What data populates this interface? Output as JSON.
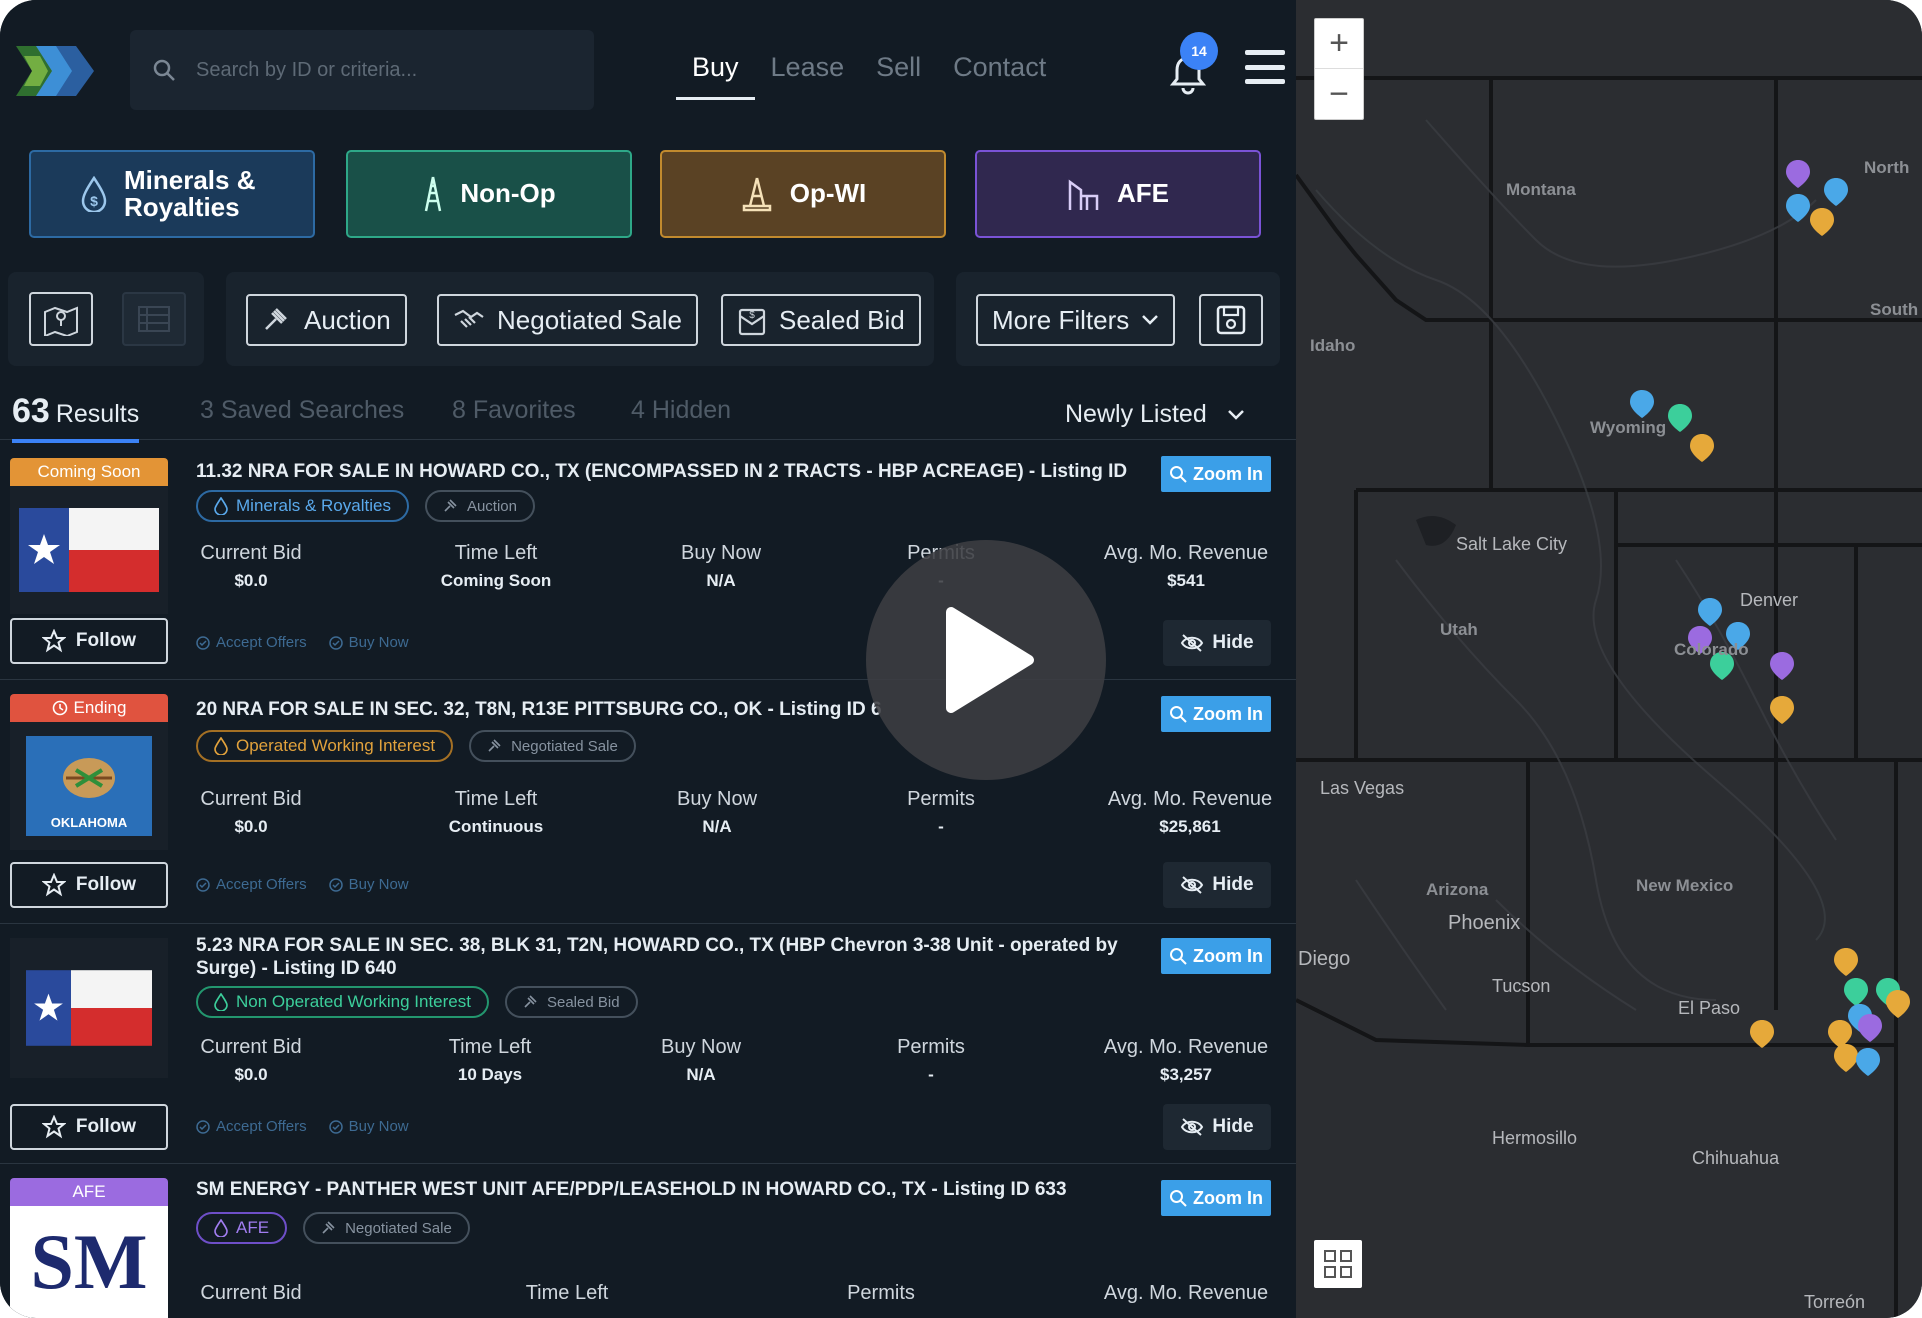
{
  "header": {
    "search_placeholder": "Search by ID or criteria...",
    "nav": [
      "Buy",
      "Lease",
      "Sell",
      "Contact"
    ],
    "active_nav": "Buy",
    "notification_count": "14"
  },
  "categories": [
    {
      "label": "Minerals & Royalties",
      "icon": "dollar-drop-icon",
      "color": "#1b3a5a"
    },
    {
      "label": "Non-Op",
      "icon": "oil-derrick-icon",
      "color": "#195048"
    },
    {
      "label": "Op-WI",
      "icon": "oil-rig-icon",
      "color": "#5a4224"
    },
    {
      "label": "AFE",
      "icon": "pumpjack-icon",
      "color": "#30284f"
    }
  ],
  "filters": {
    "auction": "Auction",
    "negotiated": "Negotiated Sale",
    "sealed": "Sealed Bid",
    "more": "More Filters"
  },
  "tabs": {
    "results_count": "63",
    "results_label": "Results",
    "saved": "3 Saved Searches",
    "favorites": "8 Favorites",
    "hidden": "4 Hidden",
    "sort": "Newly Listed"
  },
  "common": {
    "zoom_in": "Zoom In",
    "follow": "Follow",
    "hide": "Hide",
    "accept_offers": "Accept Offers",
    "buy_now": "Buy Now",
    "current_bid": "Current Bid",
    "time_left": "Time Left",
    "buy_now_label": "Buy Now",
    "permits": "Permits",
    "avg_revenue": "Avg. Mo. Revenue"
  },
  "listings": [
    {
      "status": "Coming Soon",
      "title": "11.32 NRA FOR SALE IN HOWARD CO., TX (ENCOMPASSED IN 2 TRACTS - HBP ACREAGE) - Listing ID",
      "tags": [
        "Minerals & Royalties",
        "Auction"
      ],
      "current_bid": "$0.0",
      "time_left": "Coming Soon",
      "buy_now": "N/A",
      "permits": "Permits",
      "permits_value": "-",
      "avg_revenue": "$541"
    },
    {
      "status": "Ending",
      "title": "20 NRA FOR SALE IN SEC. 32, T8N, R13E PITTSBURG CO., OK - Listing ID 6",
      "tags": [
        "Operated Working Interest",
        "Negotiated Sale"
      ],
      "current_bid": "$0.0",
      "time_left": "Continuous",
      "buy_now": "N/A",
      "permits": "-",
      "avg_revenue": "$25,861",
      "thumb_text": "OKLAHOMA"
    },
    {
      "status": "",
      "title": "5.23 NRA FOR SALE IN SEC. 38, BLK 31, T2N, HOWARD CO., TX (HBP Chevron 3-38 Unit - operated by Surge) - Listing ID 640",
      "tags": [
        "Non Operated Working Interest",
        "Sealed Bid"
      ],
      "current_bid": "$0.0",
      "time_left": "10 Days",
      "buy_now": "N/A",
      "permits": "-",
      "avg_revenue": "$3,257"
    },
    {
      "status": "AFE",
      "title": "SM ENERGY - PANTHER WEST UNIT AFE/PDP/LEASEHOLD IN HOWARD CO., TX - Listing ID 633",
      "tags": [
        "AFE",
        "Negotiated Sale"
      ],
      "thumb_text": "SM"
    }
  ],
  "map": {
    "states": [
      "Montana",
      "Idaho",
      "Wyoming",
      "Utah",
      "Colorado",
      "Arizona",
      "New Mexico",
      "North",
      "South"
    ],
    "cities": [
      "Salt Lake City",
      "Denver",
      "Las Vegas",
      "Phoenix",
      "Tucson",
      "El Paso",
      "Hermosillo",
      "Chihuahua",
      "Torreón",
      "Diego"
    ],
    "pin_colors": {
      "minerals": "#4aa8e8",
      "op": "#e6a93a",
      "non": "#3ccf9b",
      "afe": "#9b6be0"
    }
  }
}
